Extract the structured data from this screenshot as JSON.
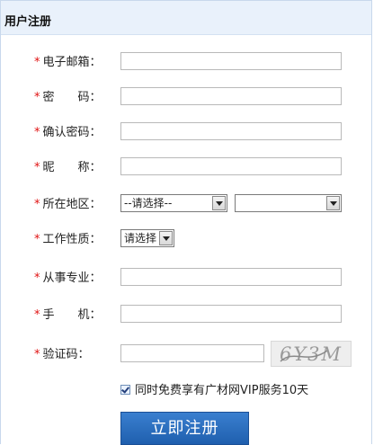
{
  "header": {
    "title": "用户注册"
  },
  "form": {
    "required_mark": "*",
    "email": {
      "label": "电子邮箱：",
      "value": ""
    },
    "password": {
      "label": "密　　码：",
      "value": ""
    },
    "confirm_password": {
      "label": "确认密码：",
      "value": ""
    },
    "nickname": {
      "label": "昵　　称：",
      "value": ""
    },
    "region": {
      "label": "所在地区：",
      "province_selected": "--请选择--",
      "city_selected": ""
    },
    "work_nature": {
      "label": "工作性质：",
      "selected": "请选择"
    },
    "profession": {
      "label": "从事专业：",
      "value": ""
    },
    "mobile": {
      "label": "手　　机：",
      "value": ""
    },
    "captcha": {
      "label": "验证码：",
      "value": "",
      "image_text": "6Y3M"
    },
    "agree": {
      "checked": true,
      "text": "同时免费享有广材网VIP服务10天"
    },
    "submit_label": "立即注册"
  }
}
